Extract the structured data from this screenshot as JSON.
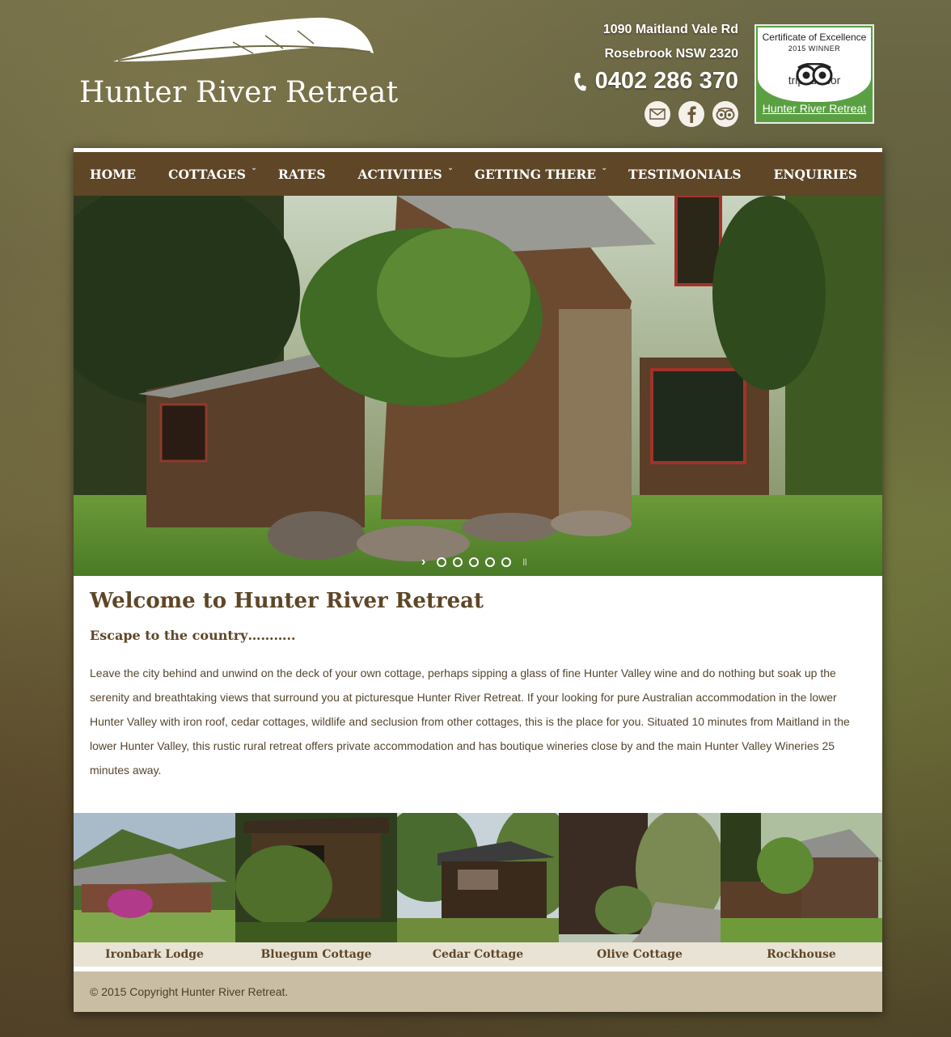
{
  "header": {
    "logo_text": "Hunter River Retreat",
    "address_line1": "1090 Maitland Vale Rd",
    "address_line2": "Rosebrook NSW 2320",
    "phone": "0402 286 370",
    "social_icons": [
      "email-icon",
      "facebook-icon",
      "tripadvisor-icon"
    ]
  },
  "certificate": {
    "title": "Certificate of Excellence",
    "winner": "2015 WINNER",
    "brand": "tripadvisor",
    "link": "Hunter River Retreat"
  },
  "nav": {
    "items": [
      {
        "label": "HOME",
        "dropdown": false
      },
      {
        "label": "COTTAGES",
        "dropdown": true
      },
      {
        "label": "RATES",
        "dropdown": false
      },
      {
        "label": "ACTIVITIES",
        "dropdown": true
      },
      {
        "label": "GETTING THERE",
        "dropdown": true
      },
      {
        "label": "TESTIMONIALS",
        "dropdown": false
      },
      {
        "label": "ENQUIRIES",
        "dropdown": false
      }
    ]
  },
  "slider": {
    "next_arrow": "›",
    "pause": "ll",
    "slide_count": 5
  },
  "main": {
    "title": "Welcome to Hunter River Retreat",
    "subtitle": "Escape to the country………..",
    "paragraph": "Leave the city behind and unwind on the deck of your own cottage, perhaps sipping a glass of fine Hunter Valley wine and do nothing but soak up the serenity and breathtaking views that surround you at picturesque Hunter River Retreat. If your looking for pure Australian accommodation in the lower Hunter Valley with iron roof, cedar cottages, wildlife and seclusion from other cottages, this is the place for you. Situated 10 minutes from Maitland in the lower Hunter Valley, this rustic rural retreat offers private accommodation and has boutique wineries close by and the main Hunter Valley Wineries 25 minutes away."
  },
  "cottages": [
    {
      "name": "Ironbark Lodge"
    },
    {
      "name": "Bluegum Cottage"
    },
    {
      "name": "Cedar Cottage"
    },
    {
      "name": "Olive Cottage"
    },
    {
      "name": "Rockhouse"
    }
  ],
  "footer": {
    "copyright": "© 2015 Copyright Hunter River Retreat."
  },
  "colors": {
    "brand_brown": "#5e4627",
    "tripadvisor_green": "#5aa043",
    "label_bg": "#e8e3d5",
    "footer_bg": "#c9bea3"
  }
}
